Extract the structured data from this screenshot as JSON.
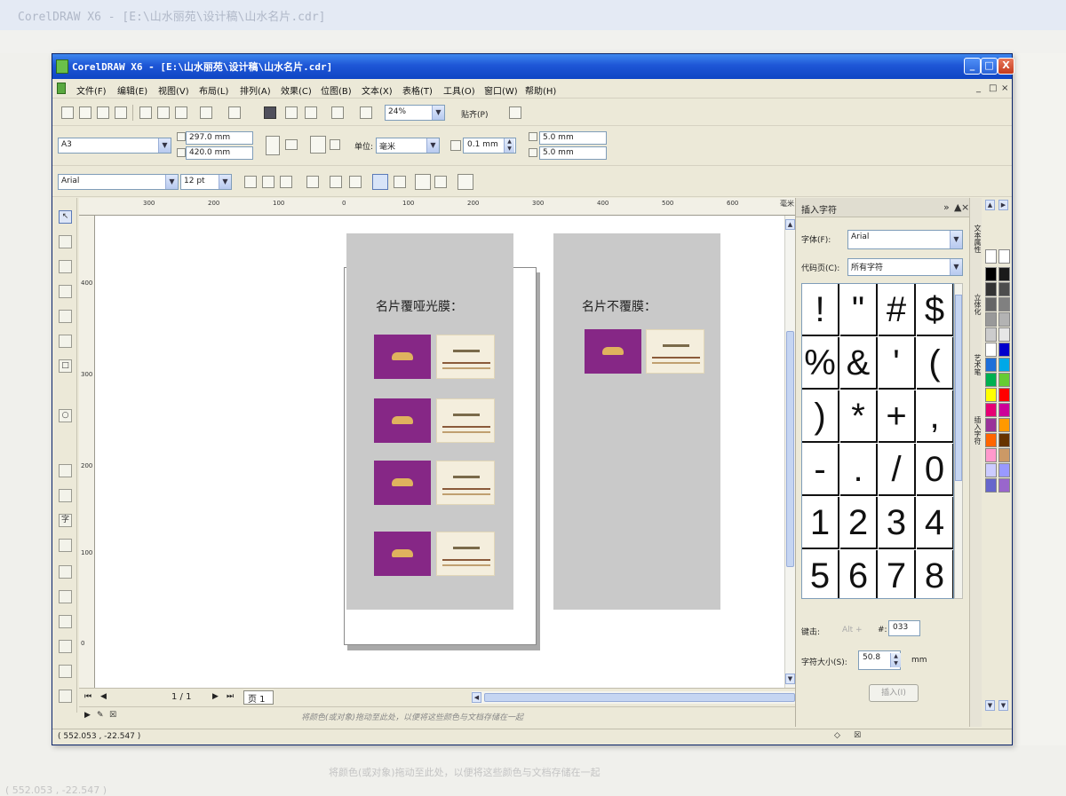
{
  "window": {
    "title": "CorelDRAW X6 - [E:\\山水丽苑\\设计稿\\山水名片.cdr]",
    "controls": [
      "_",
      "□",
      "X"
    ],
    "mdi_controls": [
      "_",
      "□",
      "×"
    ]
  },
  "menu": [
    "文件(F)",
    "编辑(E)",
    "视图(V)",
    "布局(L)",
    "排列(A)",
    "效果(C)",
    "位图(B)",
    "文本(X)",
    "表格(T)",
    "工具(O)",
    "窗口(W)",
    "帮助(H)"
  ],
  "toolbar": {
    "zoom": "24%",
    "snap_label": "贴齐(P)"
  },
  "property_bar": {
    "paper": "A3",
    "width": "297.0 mm",
    "height": "420.0 mm",
    "unit_label": "单位:",
    "unit": "毫米",
    "nudge": "0.1 mm",
    "dup_x": "5.0 mm",
    "dup_y": "5.0 mm"
  },
  "text_bar": {
    "font": "Arial",
    "size": "12 pt"
  },
  "ruler": {
    "h_labels": [
      "300",
      "200",
      "100",
      "0",
      "100",
      "200",
      "300",
      "400",
      "500",
      "600"
    ],
    "v_labels": [
      "400",
      "300",
      "200",
      "100",
      "0"
    ],
    "unit": "毫米"
  },
  "canvas": {
    "heading_left": "名片覆哑光膜：",
    "heading_right": "名片不覆膜："
  },
  "page_nav": {
    "counter": "1 / 1",
    "tab": "页 1"
  },
  "hint": "将颜色(或对象)拖动至此处，以便将这些颜色与文档存储在一起",
  "status": {
    "coords": "( 552.053 , -22.547 )"
  },
  "docker": {
    "title": "插入字符",
    "font_label": "字体(F):",
    "font_value": "Arial",
    "codepage_label": "代码页(C):",
    "codepage_value": "所有字符",
    "glyphs": [
      "!",
      "\"",
      "#",
      "$",
      "%",
      "&",
      "'",
      "(",
      ")",
      "*",
      "+",
      ",",
      "-",
      ".",
      "/",
      "0",
      "1",
      "2",
      "3",
      "4",
      "5",
      "6",
      "7",
      "8"
    ],
    "key_label": "键击:",
    "alt_label": "Alt +",
    "hash_label": "#:",
    "code_value": "033",
    "size_label": "字符大小(S):",
    "size_value": "50.8",
    "size_unit": "mm",
    "insert_label": "插入(I)"
  },
  "docker_tabs": [
    "文本属性",
    "立体化",
    "艺术笔",
    "插入字符"
  ],
  "palette": {
    "colors": [
      "#000000",
      "#1a1a1a",
      "#333333",
      "#4d4d4d",
      "#666666",
      "#808080",
      "#999999",
      "#b3b3b3",
      "#cccccc",
      "#e6e6e6",
      "#ffffff",
      "#0000cc",
      "#1e6fd9",
      "#00a8e8",
      "#00b050",
      "#66cc33",
      "#ffff00",
      "#ff0000",
      "#e60073",
      "#cc0099",
      "#993399",
      "#ff9900",
      "#ff6600",
      "#663300",
      "#ff99cc",
      "#cc9966",
      "#ccccff",
      "#9999ff",
      "#6666cc",
      "#9966cc"
    ]
  }
}
